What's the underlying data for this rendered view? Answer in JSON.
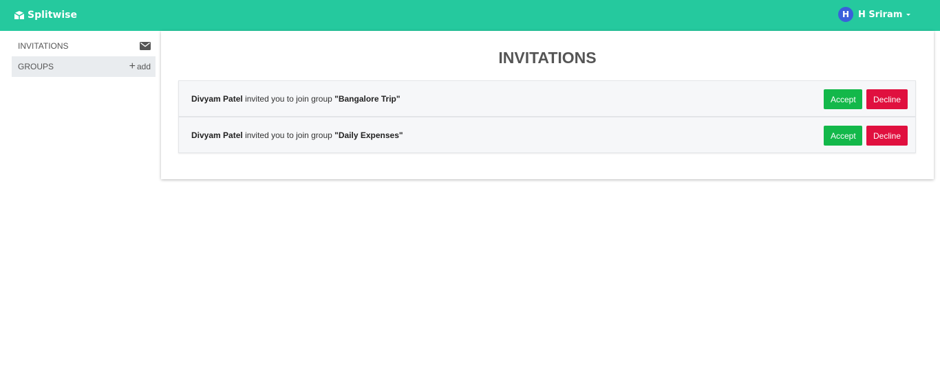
{
  "navbar": {
    "brand": "Splitwise",
    "user_initial": "H",
    "user_name": "H Sriram"
  },
  "sidebar": {
    "items": [
      {
        "label": "INVITATIONS",
        "icon": "envelope-icon"
      },
      {
        "label": "GROUPS",
        "action": "add"
      }
    ]
  },
  "main": {
    "title": "INVITATIONS",
    "invitations": [
      {
        "inviter": "Divyam Patel",
        "text": "invited you to join group",
        "group": "\"Bangalore Trip\"",
        "accept": "Accept",
        "decline": "Decline"
      },
      {
        "inviter": "Divyam Patel",
        "text": "invited you to join group",
        "group": "\"Daily Expenses\"",
        "accept": "Accept",
        "decline": "Decline"
      }
    ]
  },
  "colors": {
    "navbar": "#25c99e",
    "accept": "#13b84a",
    "decline": "#e0103f",
    "avatar": "#3b5fdb"
  }
}
